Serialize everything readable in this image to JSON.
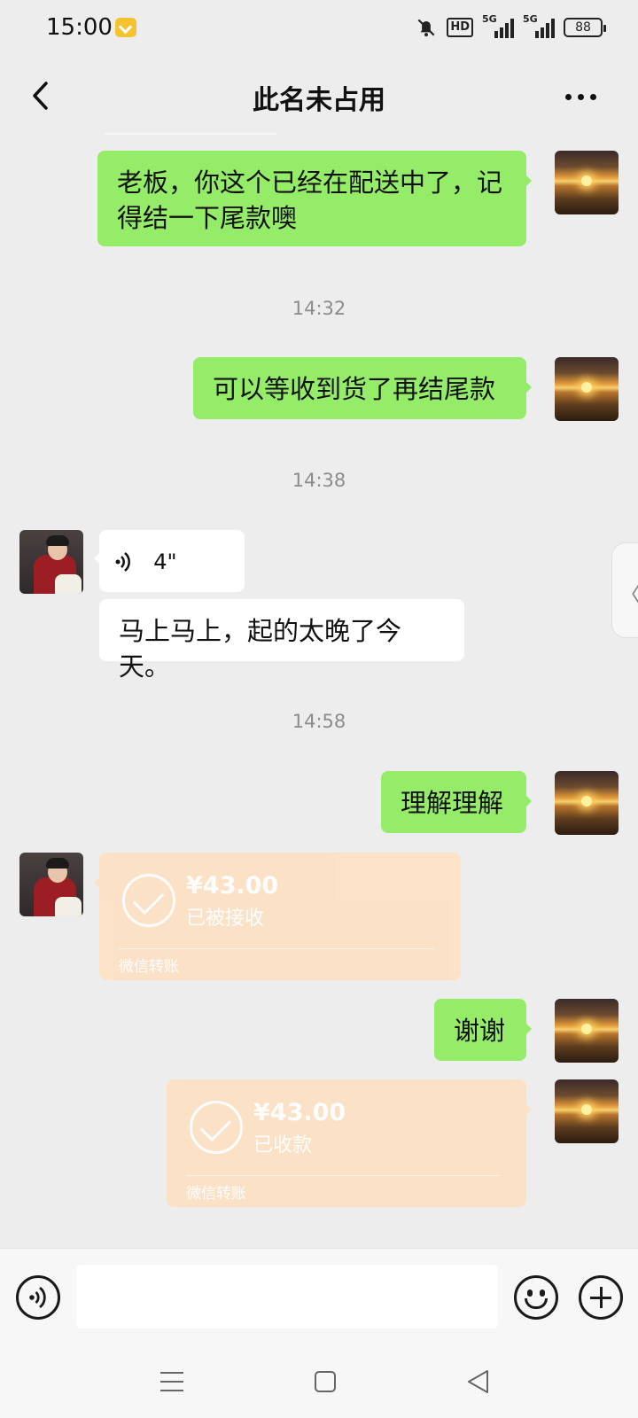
{
  "status_bar": {
    "time": "15:00",
    "network": "HD",
    "signal1_label": "5G",
    "signal2_label": "5G",
    "battery": "88",
    "icons": [
      "vip-badge-icon",
      "mute-bell-icon"
    ]
  },
  "header": {
    "title": "此名未占用",
    "back_icon": "chevron-left-icon",
    "more_icon": "more-dots-icon"
  },
  "messages": [
    {
      "type": "text",
      "sender": "self",
      "text": "老板，你这个已经在配送中了，记得结一下尾款噢"
    },
    {
      "type": "time",
      "text": "14:32"
    },
    {
      "type": "text",
      "sender": "self",
      "text": "可以等收到货了再结尾款"
    },
    {
      "type": "time",
      "text": "14:38"
    },
    {
      "type": "voice",
      "sender": "other",
      "duration": "4\""
    },
    {
      "type": "text",
      "sender": "other",
      "text": "马上马上，起的太晚了今天。"
    },
    {
      "type": "time",
      "text": "14:58"
    },
    {
      "type": "text",
      "sender": "self",
      "text": "理解理解"
    },
    {
      "type": "transfer",
      "sender": "other",
      "amount": "¥43.00",
      "status": "已被接收",
      "brand": "微信转账"
    },
    {
      "type": "text",
      "sender": "self",
      "text": "谢谢"
    },
    {
      "type": "transfer",
      "sender": "self",
      "amount": "¥43.00",
      "status": "已收款",
      "brand": "微信转账"
    }
  ],
  "side_handle": {
    "glyph": "〈"
  },
  "input_bar": {
    "placeholder": "",
    "icons": [
      "voice-input-icon",
      "emoji-icon",
      "plus-icon"
    ]
  },
  "colors": {
    "background": "#ededed",
    "self_bubble": "#95ec69",
    "other_bubble": "#ffffff",
    "transfer_card": "#fde2c4",
    "timestamp": "#8c8c8c"
  }
}
